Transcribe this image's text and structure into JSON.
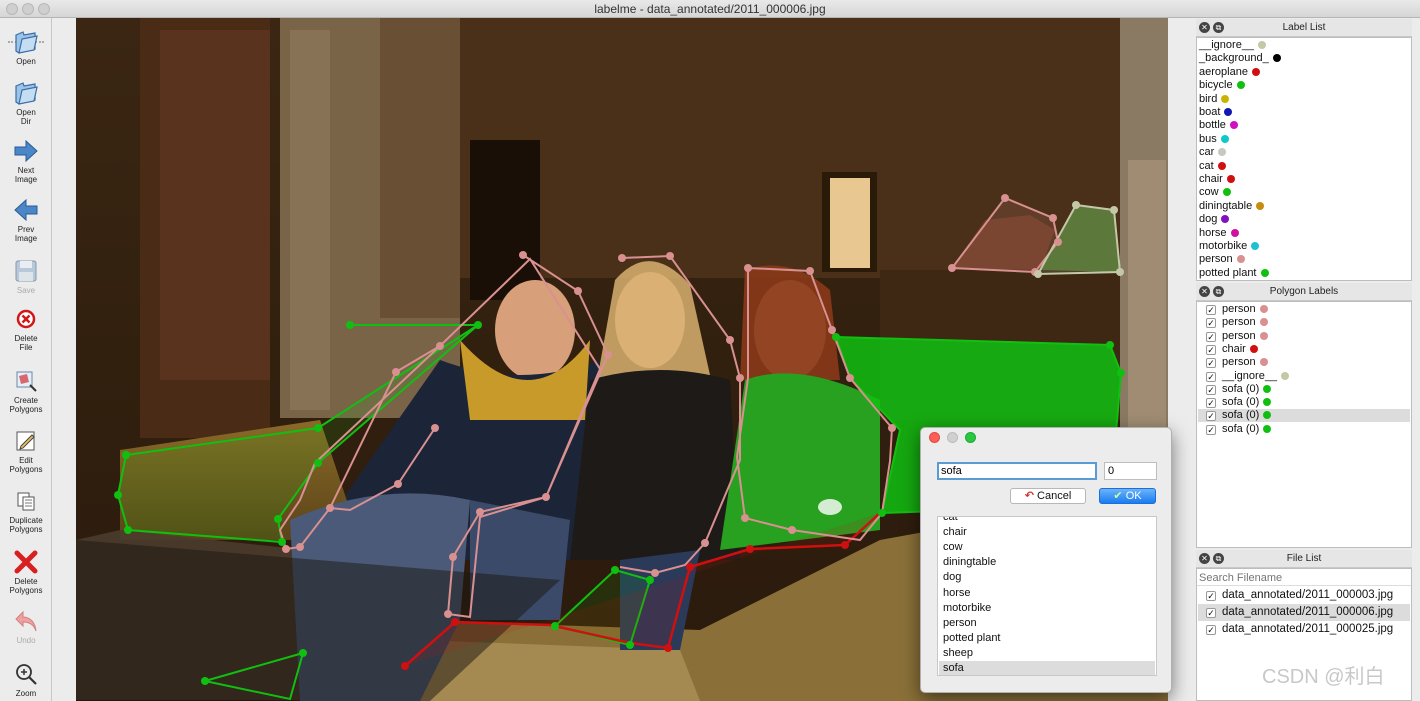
{
  "window": {
    "title": "labelme - data_annotated/2011_000006.jpg"
  },
  "toolbar": {
    "items": [
      {
        "label": "Open",
        "icon": "folder-open-icon",
        "enabled": true
      },
      {
        "label": "Open\nDir",
        "icon": "folder-open-icon",
        "enabled": true
      },
      {
        "label": "Next\nImage",
        "icon": "arrow-right-icon",
        "enabled": true
      },
      {
        "label": "Prev\nImage",
        "icon": "arrow-left-icon",
        "enabled": true
      },
      {
        "label": "Save",
        "icon": "save-icon",
        "enabled": false
      },
      {
        "label": "Delete\nFile",
        "icon": "delete-circle-icon",
        "enabled": true
      },
      {
        "label": "Create\nPolygons",
        "icon": "create-polygon-icon",
        "enabled": true
      },
      {
        "label": "Edit\nPolygons",
        "icon": "edit-icon",
        "enabled": true
      },
      {
        "label": "Duplicate\nPolygons",
        "icon": "duplicate-icon",
        "enabled": true
      },
      {
        "label": "Delete\nPolygons",
        "icon": "red-x-icon",
        "enabled": true
      },
      {
        "label": "Undo",
        "icon": "undo-icon",
        "enabled": false
      },
      {
        "label": "Zoom",
        "icon": "zoom-icon",
        "enabled": true
      }
    ]
  },
  "label_list": {
    "title": "Label List",
    "items": [
      {
        "name": "__ignore__",
        "color": "#c4c8a6"
      },
      {
        "name": "_background_",
        "color": "#000000"
      },
      {
        "name": "aeroplane",
        "color": "#d01010"
      },
      {
        "name": "bicycle",
        "color": "#10c010"
      },
      {
        "name": "bird",
        "color": "#c8b400"
      },
      {
        "name": "boat",
        "color": "#1018b0"
      },
      {
        "name": "bottle",
        "color": "#d010c0"
      },
      {
        "name": "bus",
        "color": "#10c8c8"
      },
      {
        "name": "car",
        "color": "#c8c8c0"
      },
      {
        "name": "cat",
        "color": "#d01010"
      },
      {
        "name": "chair",
        "color": "#d01010"
      },
      {
        "name": "cow",
        "color": "#10c010"
      },
      {
        "name": "diningtable",
        "color": "#c88a10"
      },
      {
        "name": "dog",
        "color": "#8010c0"
      },
      {
        "name": "horse",
        "color": "#d010a0"
      },
      {
        "name": "motorbike",
        "color": "#20c0d0"
      },
      {
        "name": "person",
        "color": "#d89090"
      },
      {
        "name": "potted plant",
        "color": "#10c010"
      }
    ]
  },
  "polygon_labels": {
    "title": "Polygon Labels",
    "items": [
      {
        "name": "person",
        "color": "#d89090",
        "selected": false
      },
      {
        "name": "person",
        "color": "#d89090",
        "selected": false
      },
      {
        "name": "person",
        "color": "#d89090",
        "selected": false
      },
      {
        "name": "chair",
        "color": "#d01010",
        "selected": false
      },
      {
        "name": "person",
        "color": "#d89090",
        "selected": false
      },
      {
        "name": "__ignore__",
        "color": "#c4c8a6",
        "selected": false
      },
      {
        "name": "sofa (0)",
        "color": "#10c010",
        "selected": false
      },
      {
        "name": "sofa (0)",
        "color": "#10c010",
        "selected": false
      },
      {
        "name": "sofa (0)",
        "color": "#10c010",
        "selected": true
      },
      {
        "name": "sofa (0)",
        "color": "#10c010",
        "selected": false
      }
    ]
  },
  "file_list": {
    "title": "File List",
    "search_placeholder": "Search Filename",
    "items": [
      {
        "name": "data_annotated/2011_000003.jpg",
        "selected": false
      },
      {
        "name": "data_annotated/2011_000006.jpg",
        "selected": true
      },
      {
        "name": "data_annotated/2011_000025.jpg",
        "selected": false
      }
    ]
  },
  "dialog": {
    "label_value": "sofa",
    "group_id_value": "0",
    "cancel_label": "Cancel",
    "ok_label": "OK",
    "list_items": [
      "cat",
      "chair",
      "cow",
      "diningtable",
      "dog",
      "horse",
      "motorbike",
      "person",
      "potted plant",
      "sheep",
      "sofa"
    ],
    "selected_item": "sofa"
  },
  "watermark": "CSDN @利白",
  "colors": {
    "person": "#d89090",
    "sofa": "#10c010",
    "chair": "#d01010",
    "ignore": "#c4c8a6"
  }
}
